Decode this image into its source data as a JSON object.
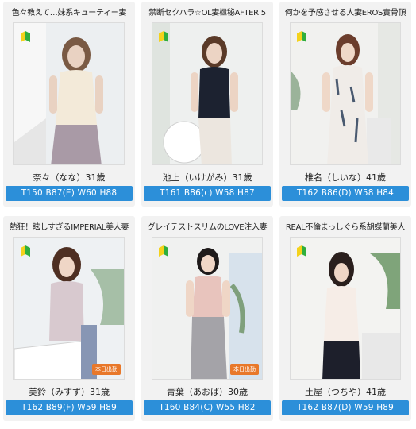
{
  "cards": [
    {
      "catch": "色々教えて…妹系キューティー妻",
      "name": "奈々（なな）31歳",
      "spec": "T150 B87(E) W60 H88",
      "badge": ""
    },
    {
      "catch": "禁断セクハラ☆OL妻極秘AFTER 5",
      "name": "池上（いけがみ）31歳",
      "spec": "T161 B86(c) W58 H87",
      "badge": ""
    },
    {
      "catch": "何かを予感させる人妻EROS責骨頂",
      "name": "椎名（しいな）41歳",
      "spec": "T162 B86(D) W58 H84",
      "badge": ""
    },
    {
      "catch": "熱狂！眩しすぎるIMPERIAL美人妻",
      "name": "美鈴（みすず）31歳",
      "spec": "T162 B89(F) W59 H89",
      "badge": "本日出勤"
    },
    {
      "catch": "グレイテストスリムのLOVE注入妻",
      "name": "青葉（あおば）30歳",
      "spec": "T160 B84(C) W55 H82",
      "badge": "本日出勤"
    },
    {
      "catch": "REAL不倫まっしぐら系胡蝶蘭美人",
      "name": "土屋（つちや）41歳",
      "spec": "T162 B87(D) W59 H89",
      "badge": ""
    }
  ],
  "colors": {
    "spec_bg": "#2c8fd9",
    "badge_bg": "#e8782a"
  },
  "icons": {
    "newbie": "beginner-mark-icon"
  }
}
